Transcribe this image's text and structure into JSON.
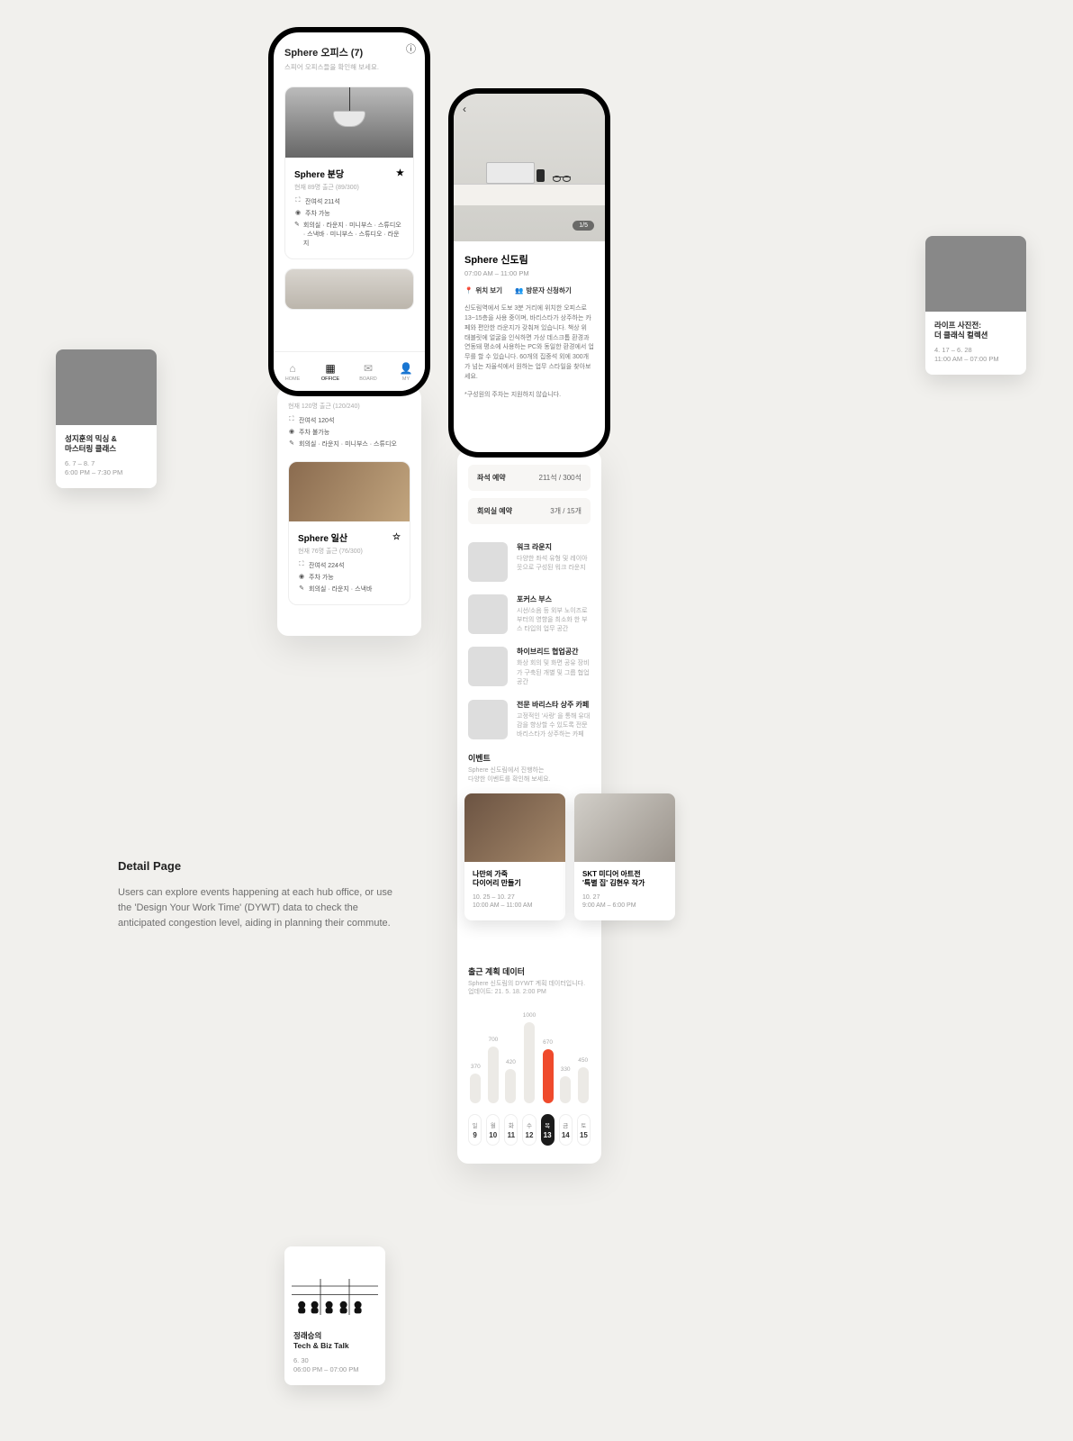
{
  "page": {
    "title": "Detail Page",
    "description": "Users can explore events happening at each hub office, or use the 'Design Your Work Time' (DYWT) data to check the anticipated congestion level, aiding in planning their commute."
  },
  "list_screen": {
    "title": "Sphere 오피스 (7)",
    "subtitle": "스피어 오피스들을 확인해 보세요.",
    "nav": [
      {
        "label": "HOME",
        "icon": "⌂"
      },
      {
        "label": "OFFICE",
        "icon": "▦",
        "active": true
      },
      {
        "label": "BOARD",
        "icon": "✉"
      },
      {
        "label": "MY",
        "icon": "👤"
      }
    ],
    "offices": [
      {
        "name": "Sphere 분당",
        "starred": true,
        "occupancy": "현재 89명 출근 (89/300)",
        "bullets": [
          {
            "icon": "⛶",
            "text": "잔여석 211석"
          },
          {
            "icon": "◉",
            "text": "주차 가능"
          },
          {
            "icon": "✎",
            "text": "회의실 · 라운지 · 미니부스 · 스튜디오 · 스낵바 · 미니부스 · 스튜디오 · 라운지"
          }
        ]
      },
      {
        "occupancy_pre": "현재 120명 출근 (120/240)",
        "bullets_pre": [
          {
            "icon": "⛶",
            "text": "잔여석 120석"
          },
          {
            "icon": "◉",
            "text": "주차 불가능"
          },
          {
            "icon": "✎",
            "text": "회의실 · 라운지 · 미니부스 · 스튜디오"
          }
        ],
        "name": "Sphere 일산",
        "starred": false,
        "occupancy": "현재 76명 출근 (76/300)",
        "bullets": [
          {
            "icon": "⛶",
            "text": "잔여석 224석"
          },
          {
            "icon": "◉",
            "text": "주차 가능"
          },
          {
            "icon": "✎",
            "text": "회의실 · 라운지 · 스낵바"
          }
        ]
      }
    ]
  },
  "detail_screen": {
    "image_count": "1/5",
    "name": "Sphere 신도림",
    "hours": "07:00 AM – 11:00 PM",
    "actions": {
      "map": "위치 보기",
      "visit": "방문자 신청하기"
    },
    "description": "신도림역에서 도보 3분 거리에 위치한 오피스로 13~15층을 사용 중이며, 바리스타가 상주하는 카페와 편안한 라운지가 갖춰져 있습니다. 책상 위 태블릿에 얼굴을 인식하면 가상 데스크톱 환경과 연동돼 평소에 사용하는 PC와 동일한 환경에서 업무를 할 수 있습니다. 60개의 집중석 외에 300개가 넘는 자율석에서 원하는 업무 스타일을 찾아보세요.",
    "note": "*구성원의 주차는 지원하지 않습니다.",
    "reservations": [
      {
        "label": "좌석 예약",
        "value": "211석 / 300석"
      },
      {
        "label": "회의실 예약",
        "value": "3개 / 15개"
      }
    ],
    "features": [
      {
        "title": "워크 라운지",
        "desc": "다양한 좌석 유형 및 레이아웃으로 구성된 워크 라운지"
      },
      {
        "title": "포커스 부스",
        "desc": "시선/소음 등 외부 노이즈로부터의 영향을 최소화 한 부스 타입의 업무 공간"
      },
      {
        "title": "하이브리드 협업공간",
        "desc": "화상 회의 및 화면 공유 장비가 구축된 개별 및 그룹 협업 공간"
      },
      {
        "title": "전문 바리스타 상주 카페",
        "desc": "고정적인 '사랑' 을 통해 유대감을 향상할 수 있도록 전문 바리스타가 상주하는 카페"
      }
    ],
    "events": {
      "title": "이벤트",
      "subtitle": "Sphere 신도림에서 진행하는\n다양한 이벤트를 확인해 보세요.",
      "items": [
        {
          "title": "나만의 가죽\n다이어리 만들기",
          "date": "10. 25 – 10. 27",
          "time": "10:00 AM – 11:00 AM"
        },
        {
          "title": "SKT 미디어 아트전\n'특별 집' 김현우 작가",
          "date": "10. 27",
          "time": "9:00 AM – 6:00 PM"
        }
      ]
    },
    "dywt": {
      "title": "출근 계획 데이터",
      "subtitle": "Sphere 신도림의 DYWT 계획 데이터입니다.\n업데이트: 21. 5. 18. 2:00 PM",
      "days": [
        {
          "name": "일",
          "num": "9"
        },
        {
          "name": "월",
          "num": "10"
        },
        {
          "name": "화",
          "num": "11"
        },
        {
          "name": "수",
          "num": "12"
        },
        {
          "name": "목",
          "num": "13",
          "active": true
        },
        {
          "name": "금",
          "num": "14"
        },
        {
          "name": "토",
          "num": "15"
        }
      ]
    }
  },
  "side_cards": {
    "headphones": {
      "title": "성지훈의 믹싱 &\n마스터링 클래스",
      "date": "6. 7 – 8. 7",
      "time": "6:00 PM – 7:30 PM"
    },
    "blue": {
      "title": "라이프 사진전:\n더 클래식 컬렉션",
      "date": "4. 17 – 6. 28",
      "time": "11:00 AM – 07:00 PM"
    },
    "talk": {
      "title": "정래승의\nTech & Biz Talk",
      "date": "6. 30",
      "time": "06:00 PM – 07:00 PM"
    }
  },
  "chart_data": {
    "type": "bar",
    "title": "출근 계획 데이터",
    "categories": [
      "일 9",
      "월 10",
      "화 11",
      "수 12",
      "목 13",
      "금 14",
      "토 15"
    ],
    "values": [
      370,
      700,
      420,
      1000,
      670,
      330,
      450
    ],
    "highlight_index": 4,
    "ylim": [
      0,
      1000
    ]
  }
}
